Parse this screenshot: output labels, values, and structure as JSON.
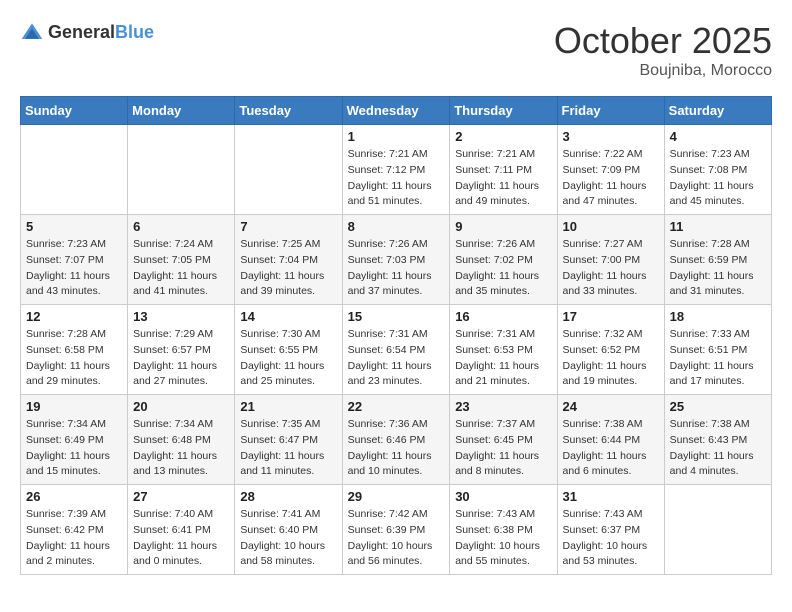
{
  "header": {
    "logo_general": "General",
    "logo_blue": "Blue",
    "month": "October 2025",
    "location": "Boujniba, Morocco"
  },
  "weekdays": [
    "Sunday",
    "Monday",
    "Tuesday",
    "Wednesday",
    "Thursday",
    "Friday",
    "Saturday"
  ],
  "weeks": [
    [
      {
        "day": "",
        "detail": ""
      },
      {
        "day": "",
        "detail": ""
      },
      {
        "day": "",
        "detail": ""
      },
      {
        "day": "1",
        "detail": "Sunrise: 7:21 AM\nSunset: 7:12 PM\nDaylight: 11 hours\nand 51 minutes."
      },
      {
        "day": "2",
        "detail": "Sunrise: 7:21 AM\nSunset: 7:11 PM\nDaylight: 11 hours\nand 49 minutes."
      },
      {
        "day": "3",
        "detail": "Sunrise: 7:22 AM\nSunset: 7:09 PM\nDaylight: 11 hours\nand 47 minutes."
      },
      {
        "day": "4",
        "detail": "Sunrise: 7:23 AM\nSunset: 7:08 PM\nDaylight: 11 hours\nand 45 minutes."
      }
    ],
    [
      {
        "day": "5",
        "detail": "Sunrise: 7:23 AM\nSunset: 7:07 PM\nDaylight: 11 hours\nand 43 minutes."
      },
      {
        "day": "6",
        "detail": "Sunrise: 7:24 AM\nSunset: 7:05 PM\nDaylight: 11 hours\nand 41 minutes."
      },
      {
        "day": "7",
        "detail": "Sunrise: 7:25 AM\nSunset: 7:04 PM\nDaylight: 11 hours\nand 39 minutes."
      },
      {
        "day": "8",
        "detail": "Sunrise: 7:26 AM\nSunset: 7:03 PM\nDaylight: 11 hours\nand 37 minutes."
      },
      {
        "day": "9",
        "detail": "Sunrise: 7:26 AM\nSunset: 7:02 PM\nDaylight: 11 hours\nand 35 minutes."
      },
      {
        "day": "10",
        "detail": "Sunrise: 7:27 AM\nSunset: 7:00 PM\nDaylight: 11 hours\nand 33 minutes."
      },
      {
        "day": "11",
        "detail": "Sunrise: 7:28 AM\nSunset: 6:59 PM\nDaylight: 11 hours\nand 31 minutes."
      }
    ],
    [
      {
        "day": "12",
        "detail": "Sunrise: 7:28 AM\nSunset: 6:58 PM\nDaylight: 11 hours\nand 29 minutes."
      },
      {
        "day": "13",
        "detail": "Sunrise: 7:29 AM\nSunset: 6:57 PM\nDaylight: 11 hours\nand 27 minutes."
      },
      {
        "day": "14",
        "detail": "Sunrise: 7:30 AM\nSunset: 6:55 PM\nDaylight: 11 hours\nand 25 minutes."
      },
      {
        "day": "15",
        "detail": "Sunrise: 7:31 AM\nSunset: 6:54 PM\nDaylight: 11 hours\nand 23 minutes."
      },
      {
        "day": "16",
        "detail": "Sunrise: 7:31 AM\nSunset: 6:53 PM\nDaylight: 11 hours\nand 21 minutes."
      },
      {
        "day": "17",
        "detail": "Sunrise: 7:32 AM\nSunset: 6:52 PM\nDaylight: 11 hours\nand 19 minutes."
      },
      {
        "day": "18",
        "detail": "Sunrise: 7:33 AM\nSunset: 6:51 PM\nDaylight: 11 hours\nand 17 minutes."
      }
    ],
    [
      {
        "day": "19",
        "detail": "Sunrise: 7:34 AM\nSunset: 6:49 PM\nDaylight: 11 hours\nand 15 minutes."
      },
      {
        "day": "20",
        "detail": "Sunrise: 7:34 AM\nSunset: 6:48 PM\nDaylight: 11 hours\nand 13 minutes."
      },
      {
        "day": "21",
        "detail": "Sunrise: 7:35 AM\nSunset: 6:47 PM\nDaylight: 11 hours\nand 11 minutes."
      },
      {
        "day": "22",
        "detail": "Sunrise: 7:36 AM\nSunset: 6:46 PM\nDaylight: 11 hours\nand 10 minutes."
      },
      {
        "day": "23",
        "detail": "Sunrise: 7:37 AM\nSunset: 6:45 PM\nDaylight: 11 hours\nand 8 minutes."
      },
      {
        "day": "24",
        "detail": "Sunrise: 7:38 AM\nSunset: 6:44 PM\nDaylight: 11 hours\nand 6 minutes."
      },
      {
        "day": "25",
        "detail": "Sunrise: 7:38 AM\nSunset: 6:43 PM\nDaylight: 11 hours\nand 4 minutes."
      }
    ],
    [
      {
        "day": "26",
        "detail": "Sunrise: 7:39 AM\nSunset: 6:42 PM\nDaylight: 11 hours\nand 2 minutes."
      },
      {
        "day": "27",
        "detail": "Sunrise: 7:40 AM\nSunset: 6:41 PM\nDaylight: 11 hours\nand 0 minutes."
      },
      {
        "day": "28",
        "detail": "Sunrise: 7:41 AM\nSunset: 6:40 PM\nDaylight: 10 hours\nand 58 minutes."
      },
      {
        "day": "29",
        "detail": "Sunrise: 7:42 AM\nSunset: 6:39 PM\nDaylight: 10 hours\nand 56 minutes."
      },
      {
        "day": "30",
        "detail": "Sunrise: 7:43 AM\nSunset: 6:38 PM\nDaylight: 10 hours\nand 55 minutes."
      },
      {
        "day": "31",
        "detail": "Sunrise: 7:43 AM\nSunset: 6:37 PM\nDaylight: 10 hours\nand 53 minutes."
      },
      {
        "day": "",
        "detail": ""
      }
    ]
  ]
}
